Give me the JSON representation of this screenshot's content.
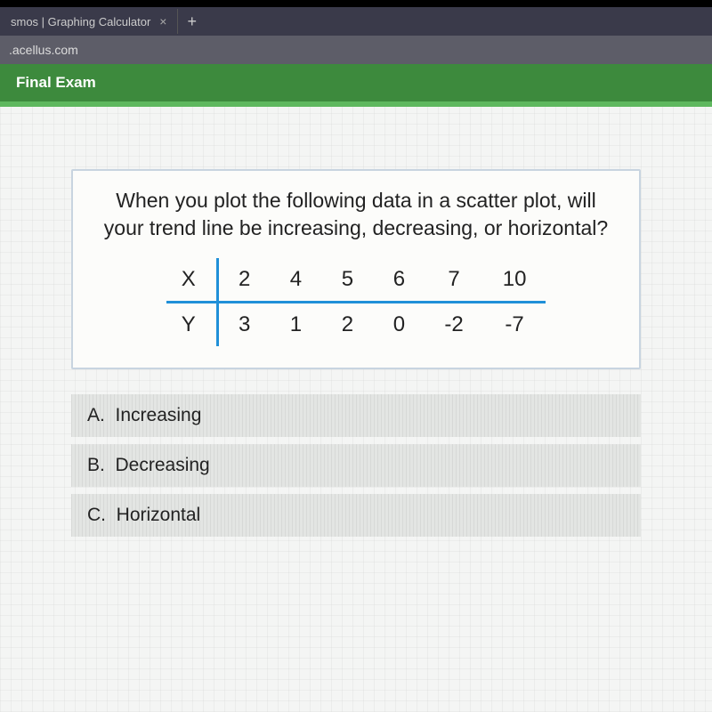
{
  "browser": {
    "tab_title": "smos | Graphing Calculator",
    "url": ".acellus.com"
  },
  "header": {
    "title": "Final Exam"
  },
  "question": {
    "prompt": "When you plot the following data in a scatter plot, will your trend line be increasing, decreasing, or horizontal?",
    "table": {
      "x_label": "X",
      "y_label": "Y",
      "x": [
        "2",
        "4",
        "5",
        "6",
        "7",
        "10"
      ],
      "y": [
        "3",
        "1",
        "2",
        "0",
        "-2",
        "-7"
      ]
    }
  },
  "answers": [
    {
      "letter": "A.",
      "text": "Increasing"
    },
    {
      "letter": "B.",
      "text": "Decreasing"
    },
    {
      "letter": "C.",
      "text": "Horizontal"
    }
  ]
}
